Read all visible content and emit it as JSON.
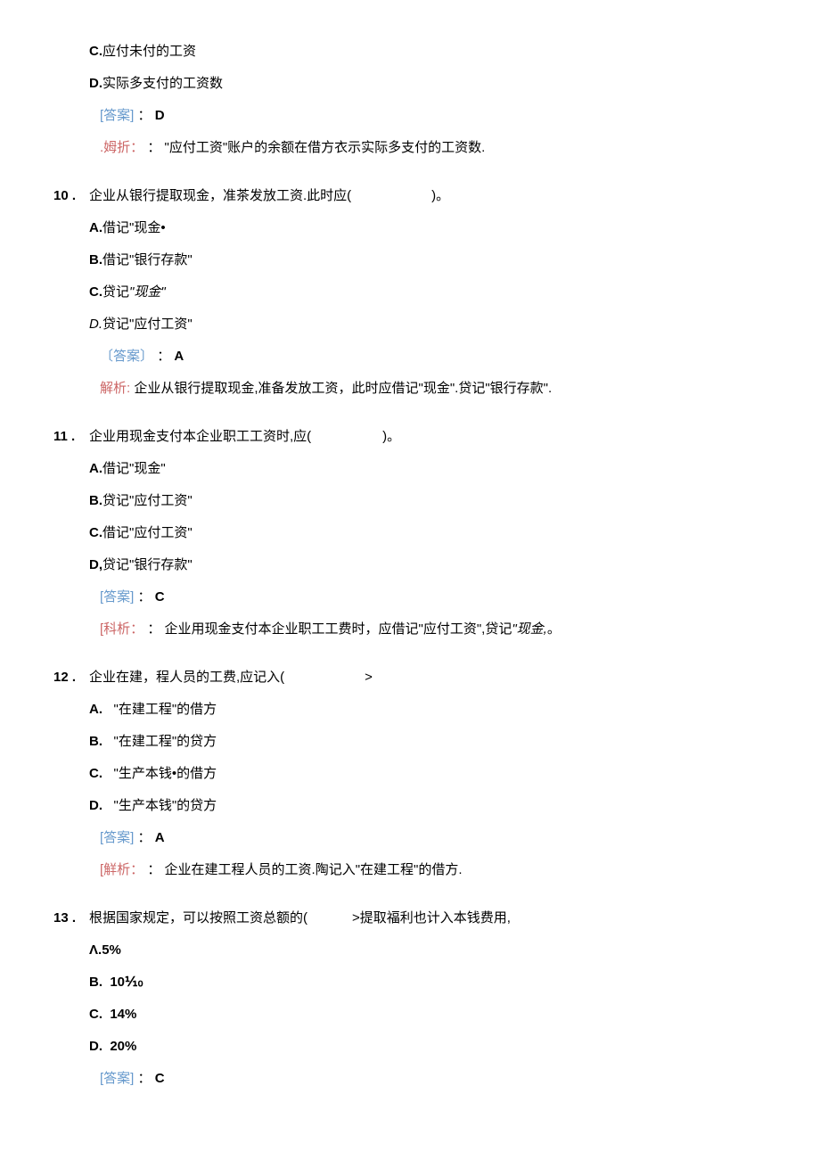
{
  "top_fragment": {
    "option_c": {
      "letter": "C.",
      "text": "应付未付的工资"
    },
    "option_d": {
      "letter": "D.",
      "text": "实际多支付的工资数"
    },
    "answer_label": "[答案]",
    "answer_sep": "：",
    "answer_value": "D",
    "analysis_label": ".姆折：",
    "analysis_sep": "：",
    "analysis_text": "\"应付工资\"账户的余额在借方衣示实际多支付的工资数."
  },
  "q10": {
    "num": "10  .",
    "stem_a": "企业从银行提取现金，准茶发放工资.此时应(",
    "stem_b": ")。",
    "option_a": {
      "letter": "A.",
      "text": "借记\"现金•"
    },
    "option_b": {
      "letter": "B.",
      "text": "借记\"银行存款\""
    },
    "option_c": {
      "letter": "C.",
      "text_pre": "贷记",
      "text_it": "\"现金\""
    },
    "option_d": {
      "letter_it": "D.",
      "text": "贷记\"应付工资\""
    },
    "answer_label": "〔答案〕",
    "answer_sep": "：",
    "answer_value": "A",
    "analysis_label": "解析:",
    "analysis_text": "企业从银行提取现金,准备发放工资，此时应借记\"现金\".贷记\"银行存款\"."
  },
  "q11": {
    "num": "11  .",
    "stem_a": "企业用现金支付本企业职工工资时,应(",
    "stem_b": ")。",
    "option_a": {
      "letter": "A.",
      "text": "借记\"现金\""
    },
    "option_b": {
      "letter": "B.",
      "text": "贷记\"应付工资\""
    },
    "option_c": {
      "letter": "C.",
      "text": "借记\"应付工资\""
    },
    "option_d": {
      "letter": "D,",
      "text": "贷记\"银行存款\""
    },
    "answer_label": "[答案]",
    "answer_sep": "：",
    "answer_value": "C",
    "analysis_label": "[科析：",
    "analysis_sep": "：",
    "analysis_text_pre": "企业用现金支付本企业职工工费时，应借记\"应付工资\",贷记",
    "analysis_text_it": "\"现金,",
    "analysis_text_post": "。"
  },
  "q12": {
    "num": "12  .",
    "stem_a": "企业在建，程人员的工费,应记入(",
    "stem_b": ">",
    "option_a": {
      "letter": "A.",
      "text": "\"在建工程\"的借方"
    },
    "option_b": {
      "letter": "B.",
      "text": "\"在建工程\"的贷方"
    },
    "option_c": {
      "letter": "C.",
      "text": "\"生产本钱•的借方"
    },
    "option_d": {
      "letter": "D.",
      "text": "\"生产本钱\"的贷方"
    },
    "answer_label": "[答案]",
    "answer_sep": "：",
    "answer_value": "A",
    "analysis_label": "[觧析：",
    "analysis_sep": "：",
    "analysis_text": "企业在建工程人员的工资.陶记入\"在建工程\"的借方."
  },
  "q13": {
    "num": "13  .",
    "stem_a": "根据国家规定，可以按照工资总额的(",
    "stem_b": ">提取福利也计入本钱费用,",
    "option_a": {
      "letter": "Λ.",
      "text": "5%"
    },
    "option_b": {
      "letter": "B.",
      "text": "10⅒"
    },
    "option_c": {
      "letter": "C.",
      "text": "14%"
    },
    "option_d": {
      "letter": "D.",
      "text": "20%"
    },
    "answer_label": "[答案]",
    "answer_sep": "：",
    "answer_value": "C"
  }
}
